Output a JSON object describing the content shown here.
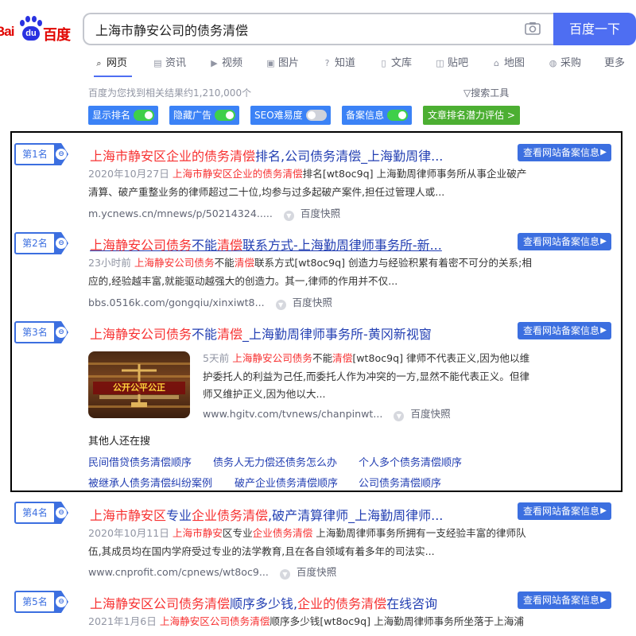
{
  "logo": {
    "latin": "Bai",
    "du": "du",
    "cn": "百度"
  },
  "search": {
    "query": "上海市静安公司的债务清偿",
    "button": "百度一下"
  },
  "tabs": [
    {
      "label": "网页",
      "icon": "search-icon"
    },
    {
      "label": "资讯",
      "icon": "news-icon"
    },
    {
      "label": "视频",
      "icon": "video-icon"
    },
    {
      "label": "图片",
      "icon": "image-icon"
    },
    {
      "label": "知道",
      "icon": "question-icon"
    },
    {
      "label": "文库",
      "icon": "doc-icon"
    },
    {
      "label": "贴吧",
      "icon": "tieba-icon"
    },
    {
      "label": "地图",
      "icon": "map-icon"
    },
    {
      "label": "采购",
      "icon": "purchase-icon"
    },
    {
      "label": "更多",
      "icon": ""
    }
  ],
  "result_count": "百度为您找到相关结果约1,210,000个",
  "search_tools": "搜索工具",
  "toggles": [
    {
      "label": "显示排名",
      "on": true
    },
    {
      "label": "隐藏广告",
      "on": true
    },
    {
      "label": "SEO难易度",
      "on": false
    },
    {
      "label": "备案信息",
      "on": true
    }
  ],
  "eval_button": "文章排名潜力评估 >",
  "beian_label": "查看网站备案信息",
  "results": [
    {
      "rank": "第1名",
      "title": [
        {
          "t": "上海市静安区企业的债务清偿",
          "h": true
        },
        {
          "t": "排名,公司债务清偿_上海勤周律...",
          "h": false
        }
      ],
      "date": "2020年10月27日",
      "abstract": [
        {
          "t": "上海市静安区企业的债务清偿",
          "h": true
        },
        {
          "t": "排名[wt8oc9q] 上海勤周律师事务所从事企业破产清算、破产重整业务的律师超过二十位,均参与过多起破产案件,担任过管理人或...",
          "h": false
        }
      ],
      "source": "m.ycnews.cn/mnews/p/50214324.....",
      "snapshot": "百度快照"
    },
    {
      "rank": "第2名",
      "title": [
        {
          "t": "上海静安公司债务",
          "h": true
        },
        {
          "t": "不能",
          "h": false
        },
        {
          "t": "清偿",
          "h": true
        },
        {
          "t": "联系方式-上海勤周律师事务所-新...",
          "h": false
        }
      ],
      "date": "23小时前",
      "abstract": [
        {
          "t": "上海静安公司债务",
          "h": true
        },
        {
          "t": "不能",
          "h": false
        },
        {
          "t": "清偿",
          "h": true
        },
        {
          "t": "联系方式[wt8oc9q] 创造力与经验积累有着密不可分的关系;相应的,经验越丰富,就能驱动越强大的创造力。其一,律师的作用并不仅...",
          "h": false
        }
      ],
      "source": "bbs.0516k.com/gongqiu/xinxiwt8...",
      "snapshot": "百度快照"
    },
    {
      "rank": "第3名",
      "title": [
        {
          "t": "上海静安公司债务",
          "h": true
        },
        {
          "t": "不能",
          "h": false
        },
        {
          "t": "清偿",
          "h": true
        },
        {
          "t": "_上海勤周律师事务所-黄冈新视窗",
          "h": false
        }
      ],
      "date": "5天前",
      "abstract": [
        {
          "t": "上海静安公司债务",
          "h": true
        },
        {
          "t": "不能",
          "h": false
        },
        {
          "t": "清偿",
          "h": true
        },
        {
          "t": "[wt8oc9q] 律师不代表正义,因为他以维护委托人的利益为己任,而委托人作为冲突的一方,显然不能代表正义。但律师又维护正义,因为他以大...",
          "h": false
        }
      ],
      "source": "www.hgitv.com/tvnews/chanpinwt...",
      "snapshot": "百度快照",
      "thumb_text": "公开公平公正"
    },
    {
      "rank": "第4名",
      "title": [
        {
          "t": "上海市静安区",
          "h": true
        },
        {
          "t": "专业",
          "h": false
        },
        {
          "t": "企业债务清偿",
          "h": true
        },
        {
          "t": ",破产清算律师_上海勤周律师...",
          "h": false
        }
      ],
      "date": "2020年10月11日",
      "abstract": [
        {
          "t": "上海市静安",
          "h": true
        },
        {
          "t": "区专业",
          "h": false
        },
        {
          "t": "企业债务清偿",
          "h": true
        },
        {
          "t": " 上海勤周律师事务所拥有一支经验丰富的律师队伍,其成员均在国内学府受过专业的法学教育,且在各自领域有着多年的司法实...",
          "h": false
        }
      ],
      "source": "www.cnprofit.com/cpnews/wt8oc9...",
      "snapshot": "百度快照"
    },
    {
      "rank": "第5名",
      "title": [
        {
          "t": "上海静安区公司债务清偿",
          "h": true
        },
        {
          "t": "顺序多少钱,",
          "h": false
        },
        {
          "t": "企业的债务清偿",
          "h": true
        },
        {
          "t": "在线咨询",
          "h": false
        }
      ],
      "date": "2021年1月6日",
      "abstract": [
        {
          "t": "上海静安区公司债务清偿",
          "h": true
        },
        {
          "t": "顺序多少钱[wt8oc9q] 上海勤周律师事务所坐落于上海浦",
          "h": false
        }
      ],
      "source": "",
      "snapshot": ""
    }
  ],
  "others": {
    "title": "其他人还在搜",
    "links": [
      "民间借贷债务清偿顺序",
      "债务人无力偿还债务怎么办",
      "个人多个债务清偿顺序",
      "被继承人债务清偿纠纷案例",
      "破产企业债务清偿顺序",
      "公司债务清偿顺序"
    ]
  },
  "colors": {
    "accent": "#4e6ef2",
    "title_link": "#2440b3",
    "highlight": "#f73131",
    "rank_blue": "#3c6fe0",
    "switch_on": "#3ecf4a"
  }
}
